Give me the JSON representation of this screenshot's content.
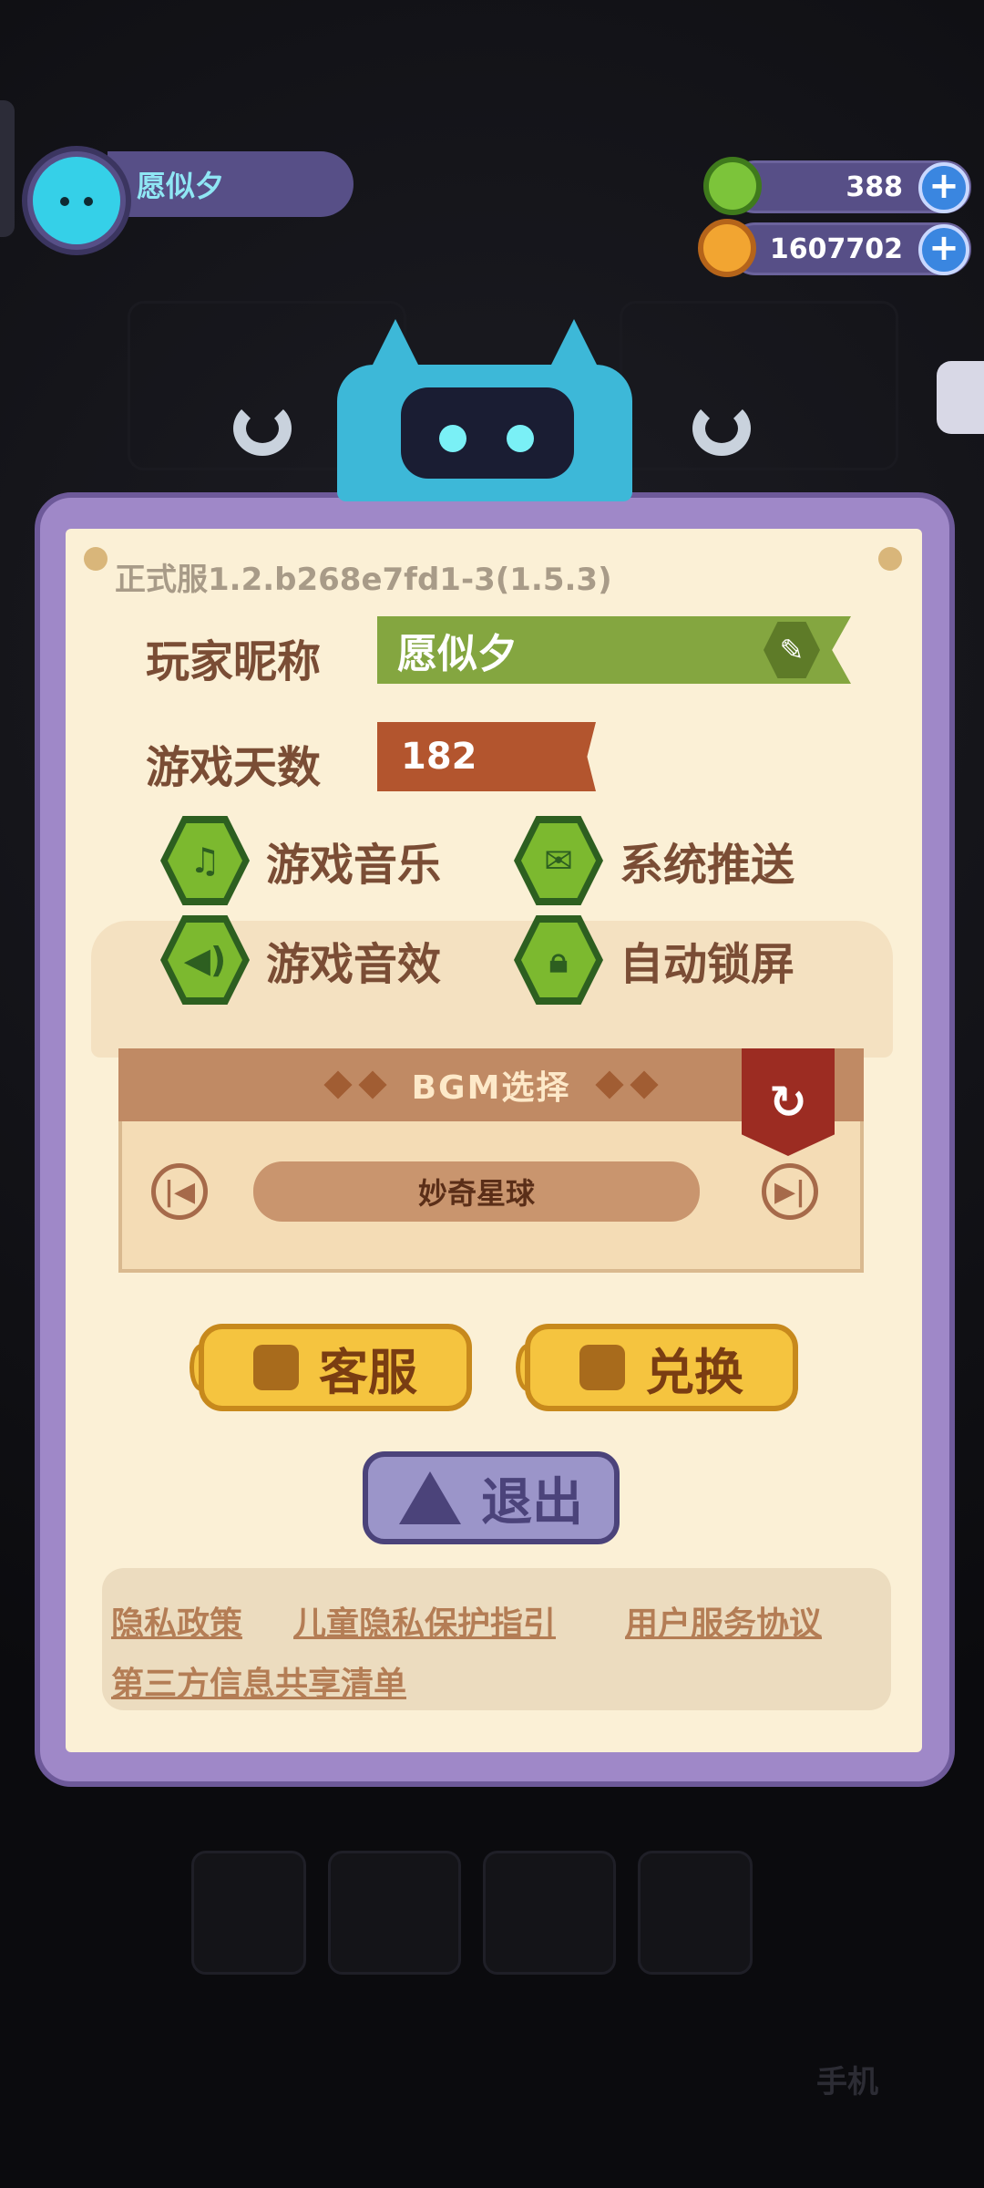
{
  "player": {
    "name": "愿似夕"
  },
  "currency": {
    "gems": "388",
    "coins": "1607702"
  },
  "settings": {
    "version": "正式服1.2.b268e7fd1-3(1.5.3)",
    "nickname_label": "玩家昵称",
    "nickname_value": "愿似夕",
    "days_label": "游戏天数",
    "days_value": "182",
    "toggles": {
      "music": "游戏音乐",
      "push": "系统推送",
      "sfx": "游戏音效",
      "lock": "自动锁屏"
    },
    "bgm": {
      "title": "BGM选择",
      "current_song": "妙奇星球"
    },
    "buttons": {
      "service": "客服",
      "redeem": "兑换",
      "exit": "退出"
    },
    "links": [
      "隐私政策",
      "儿童隐私保护指引",
      "用户服务协议",
      "第三方信息共享清单"
    ]
  },
  "background_label": "手机",
  "colors": {
    "panel_border": "#9f88c8",
    "paper": "#fbf0d6",
    "nickname_bar": "#84a640",
    "days_bar": "#b3552e",
    "gold": "#f5c43f",
    "toggle_green": "#7cb92f"
  }
}
